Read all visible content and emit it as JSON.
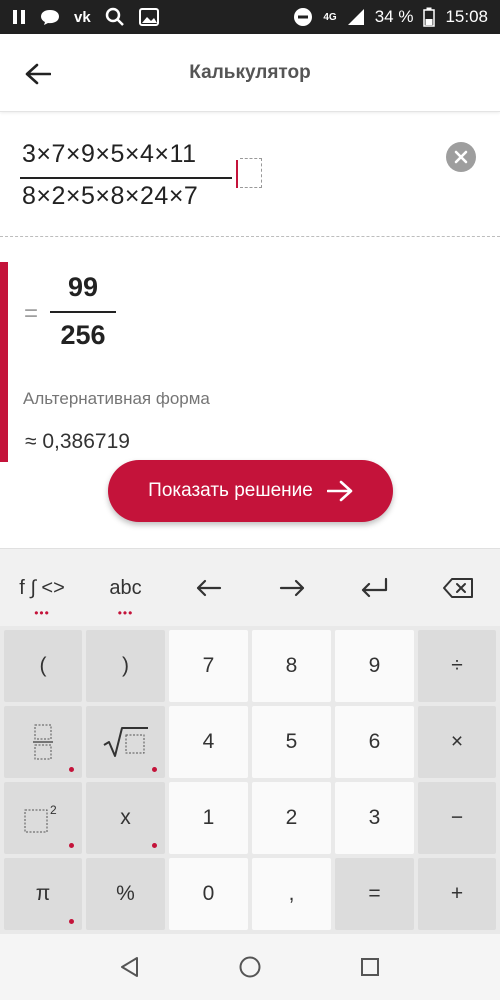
{
  "status_bar": {
    "network": "4G",
    "battery": "34 %",
    "time": "15:08",
    "icons": [
      "pause-icon",
      "chat-icon",
      "vk-icon",
      "search-icon",
      "image-icon",
      "dnd-icon",
      "signal-icon",
      "battery-icon"
    ]
  },
  "app_bar": {
    "title": "Калькулятор",
    "back_icon": "arrow-left-icon"
  },
  "expression": {
    "numerator": "3×7×9×5×4×11",
    "denominator": "8×2×5×8×24×7",
    "clear_icon": "close-circle-icon"
  },
  "result": {
    "equals": "=",
    "numerator": "99",
    "denominator": "256",
    "alt_form_label": "Альтернативная форма",
    "approx_value": "≈ 0,386719",
    "show_solution_label": "Показать решение",
    "accent_color": "#c4133a"
  },
  "keyboard": {
    "toolbar": {
      "functions_label": "f ∫ <>",
      "abc_label": "abc",
      "left_arrow": "←",
      "right_arrow": "→",
      "enter": "↵",
      "backspace_icon": "backspace-icon"
    },
    "rows": [
      [
        "(",
        ")",
        "7",
        "8",
        "9",
        "÷"
      ],
      [
        "fraction",
        "sqrt",
        "4",
        "5",
        "6",
        "×"
      ],
      [
        "square",
        "x",
        "1",
        "2",
        "3",
        "−"
      ],
      [
        "π",
        "%",
        "0",
        ",",
        "=",
        "+"
      ]
    ]
  },
  "nav_bar": {
    "icons": [
      "back-triangle-icon",
      "home-circle-icon",
      "recents-square-icon"
    ]
  }
}
